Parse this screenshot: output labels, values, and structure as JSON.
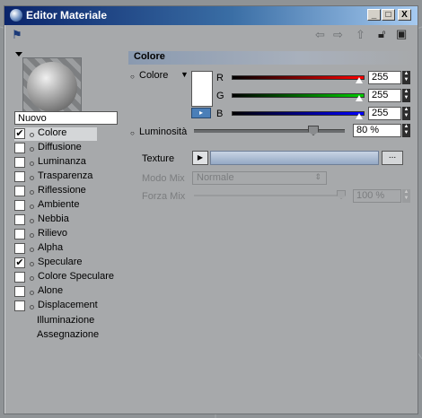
{
  "window": {
    "title": "Editor Materiale",
    "controls": {
      "minimize": "_",
      "maximize": "□",
      "close": "X"
    }
  },
  "toolbar": {
    "icons": [
      "pin-icon",
      "arrow-left-icon",
      "arrow-right-icon",
      "arrow-up-icon",
      "lock-icon",
      "panel-icon"
    ]
  },
  "material": {
    "name": "Nuovo"
  },
  "channels": [
    {
      "label": "Colore",
      "checked": true,
      "selected": true
    },
    {
      "label": "Diffusione",
      "checked": false
    },
    {
      "label": "Luminanza",
      "checked": false
    },
    {
      "label": "Trasparenza",
      "checked": false
    },
    {
      "label": "Riflessione",
      "checked": false
    },
    {
      "label": "Ambiente",
      "checked": false
    },
    {
      "label": "Nebbia",
      "checked": false
    },
    {
      "label": "Rilievo",
      "checked": false
    },
    {
      "label": "Alpha",
      "checked": false
    },
    {
      "label": "Speculare",
      "checked": true
    },
    {
      "label": "Colore Speculare",
      "checked": false
    },
    {
      "label": "Alone",
      "checked": false
    },
    {
      "label": "Displacement",
      "checked": false
    }
  ],
  "extra_items": [
    "Illuminazione",
    "Assegnazione"
  ],
  "panel": {
    "section_title": "Colore",
    "color_label": "Colore",
    "r_label": "R",
    "g_label": "G",
    "b_label": "B",
    "r_value": "255",
    "g_value": "255",
    "b_value": "255",
    "luminosita_label": "Luminosità",
    "luminosita_value": "80 %",
    "texture_label": "Texture",
    "texture_more": "...",
    "mix_label": "Modo Mix",
    "mix_value": "Normale",
    "forza_label": "Forza Mix",
    "forza_value": "100 %"
  },
  "colors": {
    "r_track": "#ff0000",
    "g_track": "#00cc00",
    "b_track": "#0000ff",
    "swatch": "#ffffff",
    "titlebar": "#0a246a"
  },
  "levels": {
    "luminosita": 0.8,
    "forza_mix": 1.0,
    "r": 1.0,
    "g": 1.0,
    "b": 1.0
  }
}
